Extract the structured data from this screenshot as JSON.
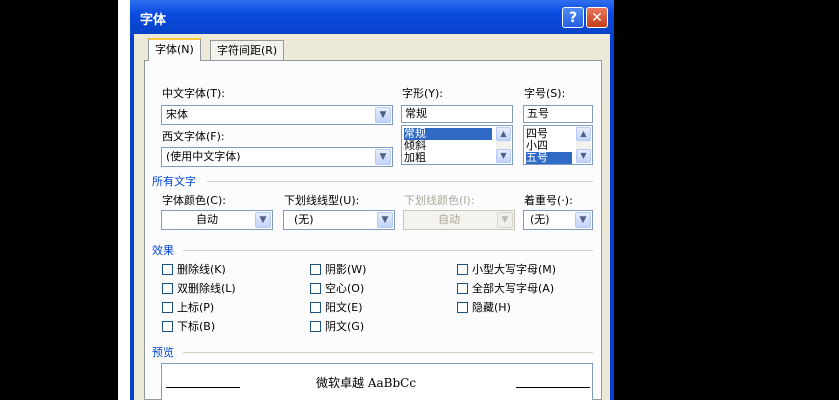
{
  "window": {
    "title": "字体",
    "help_label": "?",
    "close_label": "✕"
  },
  "tabs": [
    {
      "label": "字体(N)",
      "active": true
    },
    {
      "label": "字符间距(R)",
      "active": false
    }
  ],
  "font": {
    "cn_font_label": "中文字体(T):",
    "cn_font_value": "宋体",
    "west_font_label": "西文字体(F):",
    "west_font_value": "(使用中文字体)",
    "style_label": "字形(Y):",
    "style_value": "常规",
    "style_options": [
      "常规",
      "倾斜",
      "加粗"
    ],
    "size_label": "字号(S):",
    "size_value": "五号",
    "size_options": [
      "四号",
      "小四",
      "五号"
    ]
  },
  "all_text": {
    "section_label": "所有文字",
    "color_label": "字体颜色(C):",
    "color_value": "自动",
    "underline_label": "下划线线型(U):",
    "underline_value": "(无)",
    "underline_color_label": "下划线颜色(I):",
    "underline_color_value": "自动",
    "emphasis_label": "着重号(·):",
    "emphasis_value": "(无)"
  },
  "effects": {
    "section_label": "效果",
    "items": [
      "删除线(K)",
      "阴影(W)",
      "小型大写字母(M)",
      "双删除线(L)",
      "空心(O)",
      "全部大写字母(A)",
      "上标(P)",
      "阳文(E)",
      "隐藏(H)",
      "下标(B)",
      "阴文(G)"
    ]
  },
  "preview": {
    "section_label": "预览",
    "text": "微软卓越 AaBbCc"
  },
  "colors": {
    "titlebar": "#0a4be0",
    "selection": "#316ac5",
    "section": "#0046d5",
    "dialog_bg": "#ece9d8"
  }
}
